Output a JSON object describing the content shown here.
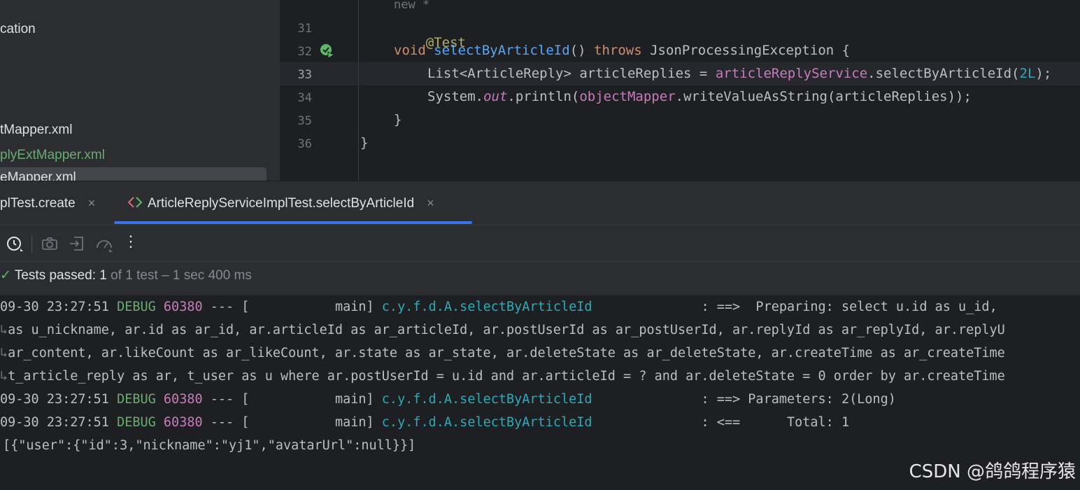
{
  "project_tree": {
    "items": [
      {
        "label": "cation",
        "color": "#dfe1e5"
      },
      {
        "label": "tMapper.xml",
        "color": "#dfe1e5"
      },
      {
        "label": "plyExtMapper.xml",
        "color": "#6aab73"
      },
      {
        "label": "eMapper.xml",
        "color": "#dfe1e5"
      }
    ]
  },
  "editor": {
    "top_hint": "new *",
    "line_numbers": [
      "31",
      "32",
      "33",
      "34",
      "35",
      "36"
    ],
    "line31": {
      "annotation": "@Test"
    },
    "line32": {
      "kw_void": "void",
      "method": "selectByArticleId",
      "paren": "() ",
      "kw_throws": "throws",
      "exc": " JsonProcessingException {"
    },
    "line33": {
      "type": "List<ArticleReply> articleReplies = ",
      "service": "articleReplyService",
      "call": ".selectByArticleId(",
      "arg": "2L",
      "end": ");"
    },
    "line34": {
      "sys": "System.",
      "out": "out",
      "println": ".println(",
      "mapper": "objectMapper",
      "rest": ".writeValueAsString(articleReplies));"
    },
    "line35": "}",
    "line36": "}"
  },
  "tabs": [
    {
      "label": "plTest.create",
      "close": "×",
      "active": false
    },
    {
      "label": "ArticleReplyServiceImplTest.selectByArticleId",
      "close": "×",
      "active": true
    }
  ],
  "toolbar": {
    "icons": [
      "history-icon",
      "camera-icon",
      "import-icon",
      "coverage-icon",
      "more-icon"
    ],
    "more_glyph": "⋮"
  },
  "status": {
    "check": "✓",
    "label": "Tests passed:",
    "count": " 1",
    "detail": " of 1 test – 1 sec 400 ms"
  },
  "console": {
    "log1": {
      "ts": "09-30 23:27:51 ",
      "level": "DEBUG",
      "pid": " 60380",
      "mid": " --- [           main] ",
      "logger": "c.y.f.d.A.selectByArticleId",
      "msg": "              : ==>  Preparing: select u.id as u_id,"
    },
    "wrap1": "as u_nickname, ar.id as ar_id, ar.articleId as ar_articleId, ar.postUserId as ar_postUserId, ar.replyId as ar_replyId, ar.replyU",
    "wrap2": "ar_content, ar.likeCount as ar_likeCount, ar.state as ar_state, ar.deleteState as ar_deleteState, ar.createTime as ar_createTime",
    "wrap3": "t_article_reply as ar, t_user as u where ar.postUserId = u.id and ar.articleId = ? and ar.deleteState = 0 order by ar.createTime",
    "wrap_glyph": "↳",
    "log2": {
      "ts": "09-30 23:27:51 ",
      "level": "DEBUG",
      "pid": " 60380",
      "mid": " --- [           main] ",
      "logger": "c.y.f.d.A.selectByArticleId",
      "msg": "              : ==> Parameters: 2(Long)"
    },
    "log3": {
      "ts": "09-30 23:27:51 ",
      "level": "DEBUG",
      "pid": " 60380",
      "mid": " --- [           main] ",
      "logger": "c.y.f.d.A.selectByArticleId",
      "msg": "              : <==      Total: 1"
    },
    "json": "[{\"user\":{\"id\":3,\"nickname\":\"yj1\",\"avatarUrl\":null}}]"
  },
  "watermark": "CSDN @鸽鸽程序猿",
  "colors": {
    "accent": "#3574f0",
    "success": "#5fb865"
  }
}
